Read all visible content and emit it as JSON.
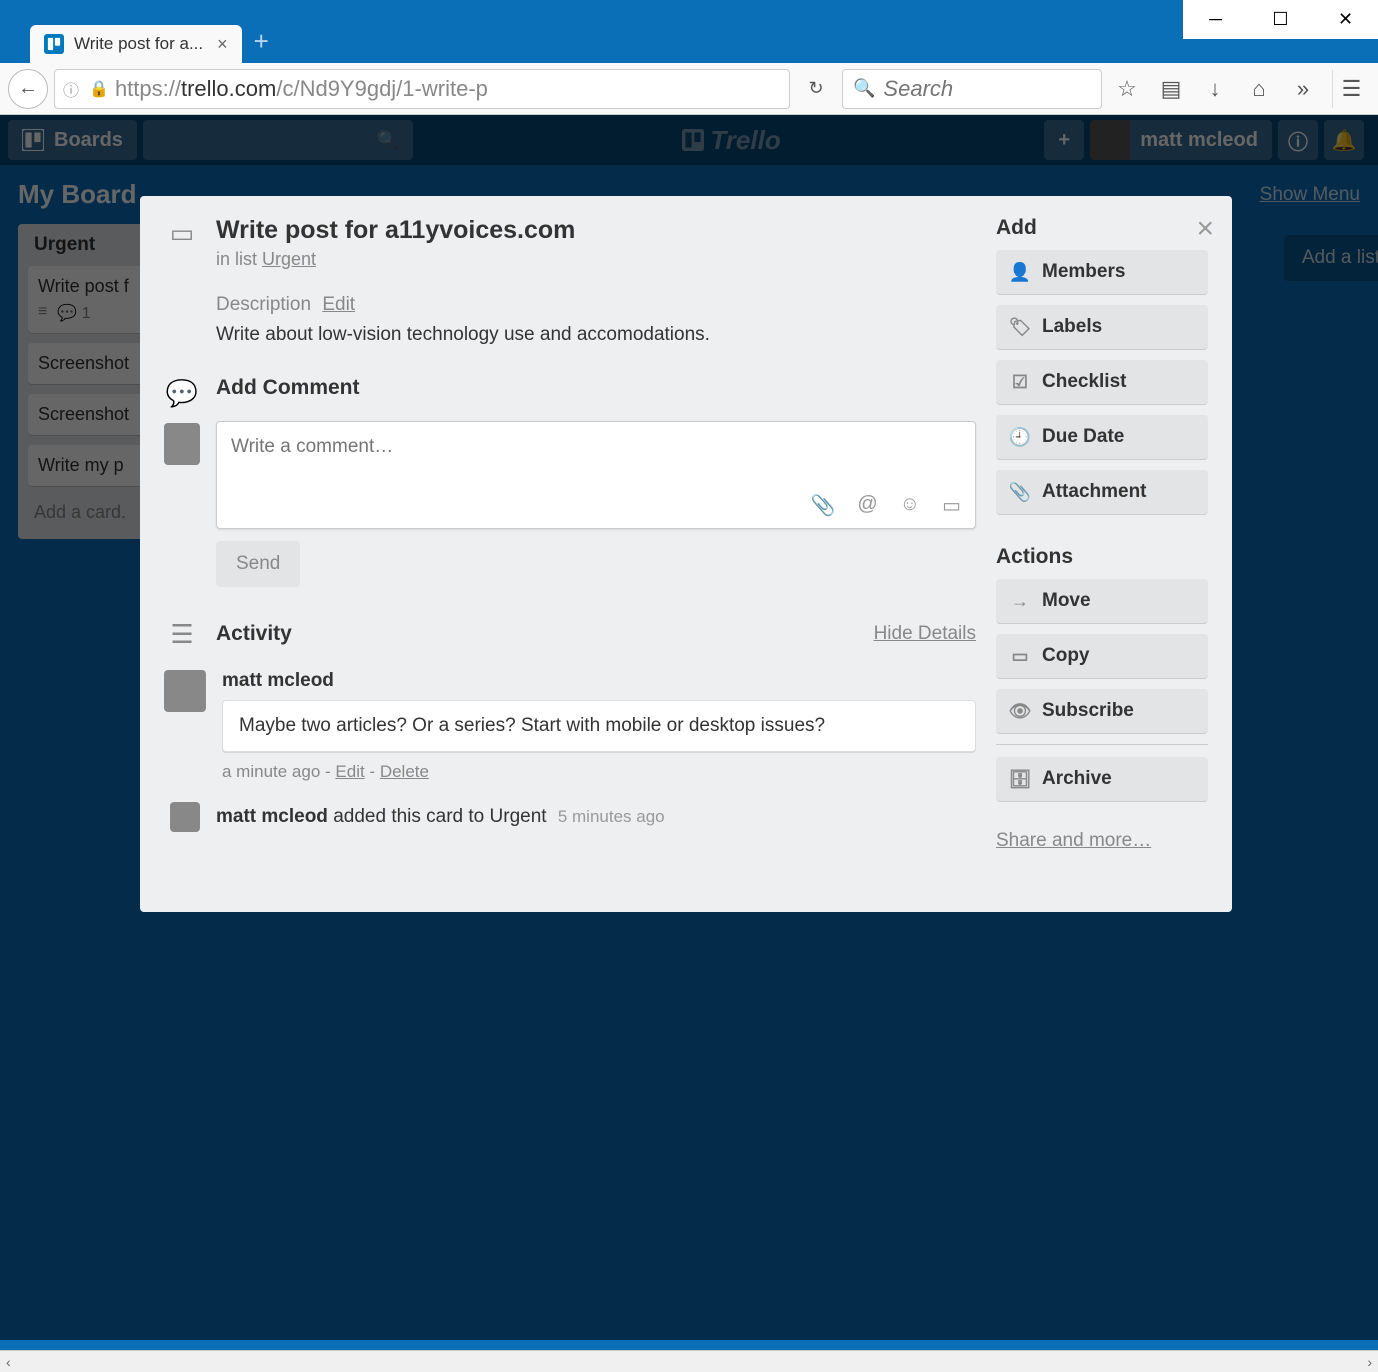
{
  "window": {
    "tab_title": "Write post for a...",
    "url_host": "trello.com",
    "url_path": "/c/Nd9Y9gdj/1-write-p",
    "url_prefix": "https://",
    "search_placeholder": "Search"
  },
  "trello_header": {
    "boards_label": "Boards",
    "logo_text": "Trello",
    "username": "matt mcleod"
  },
  "board": {
    "title": "My Board",
    "show_menu": "Show Menu",
    "add_list": "Add a list",
    "list": {
      "name": "Urgent",
      "cards": [
        {
          "title": "Write post f",
          "badge_count": "1"
        },
        {
          "title": "Screenshot"
        },
        {
          "title": "Screenshot"
        },
        {
          "title": "Write my p"
        }
      ],
      "add_card": "Add a card."
    }
  },
  "card_modal": {
    "title": "Write post for a11yvoices.com",
    "in_list_prefix": "in list ",
    "in_list_name": "Urgent",
    "description_label": "Description",
    "edit_label": "Edit",
    "description_text": "Write about low-vision technology use and accomodations.",
    "add_comment_label": "Add Comment",
    "comment_placeholder": "Write a comment…",
    "send_label": "Send",
    "activity_label": "Activity",
    "hide_details": "Hide Details",
    "comment": {
      "user": "matt mcleod",
      "text": "Maybe two articles? Or a series? Start with mobile or desktop issues?",
      "when": "a minute ago",
      "edit": "Edit",
      "delete": "Delete"
    },
    "log": {
      "user": "matt mcleod",
      "action": " added this card to Urgent",
      "when": "5 minutes ago"
    },
    "sidebar": {
      "add_heading": "Add",
      "add_items": [
        "Members",
        "Labels",
        "Checklist",
        "Due Date",
        "Attachment"
      ],
      "actions_heading": "Actions",
      "action_items": [
        "Move",
        "Copy",
        "Subscribe",
        "Archive"
      ],
      "share_more": "Share and more…"
    }
  }
}
